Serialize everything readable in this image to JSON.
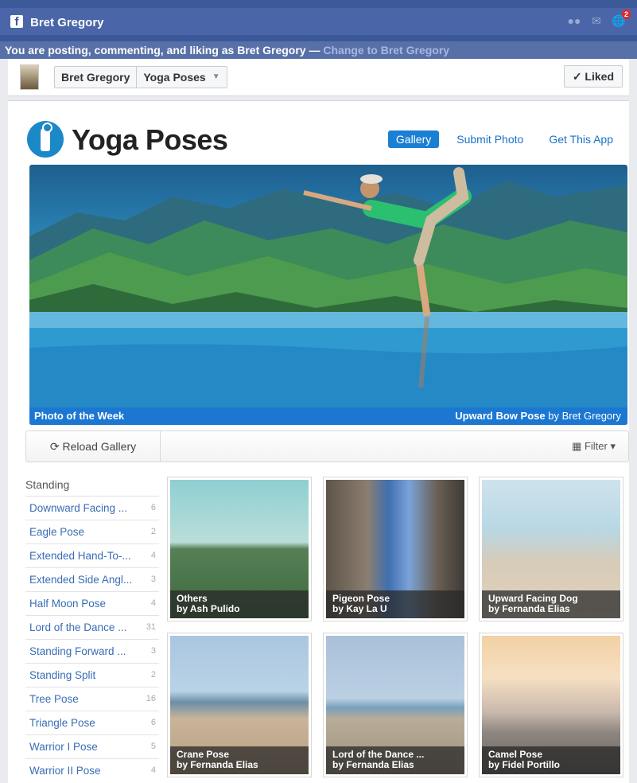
{
  "fb": {
    "user_name": "Bret Gregory",
    "notification_count": "2"
  },
  "posting_bar": {
    "message": "You are posting, commenting, and liking as Bret Gregory — ",
    "change_link": "Change to Bret Gregory"
  },
  "page_bar": {
    "profile": "Bret Gregory",
    "page": "Yoga Poses",
    "liked_label": "✓ Liked"
  },
  "app": {
    "title": "Yoga Poses",
    "nav": [
      {
        "label": "Gallery",
        "active": true
      },
      {
        "label": "Submit Photo",
        "active": false
      },
      {
        "label": "Get This App",
        "active": false
      }
    ]
  },
  "hero": {
    "caption_left": "Photo of the Week",
    "pose": "Upward Bow Pose",
    "by_word": " by ",
    "author": "Bret Gregory"
  },
  "toolbar": {
    "reload_label": "Reload Gallery",
    "filter_label": "Filter"
  },
  "sidebar": {
    "heading": "Standing",
    "items": [
      {
        "label": "Downward Facing ...",
        "count": "6"
      },
      {
        "label": "Eagle Pose",
        "count": "2"
      },
      {
        "label": "Extended Hand-To-...",
        "count": "4"
      },
      {
        "label": "Extended Side Angl...",
        "count": "3"
      },
      {
        "label": "Half Moon Pose",
        "count": "4"
      },
      {
        "label": "Lord of the Dance ...",
        "count": "31"
      },
      {
        "label": "Standing Forward ...",
        "count": "3"
      },
      {
        "label": "Standing Split",
        "count": "2"
      },
      {
        "label": "Tree Pose",
        "count": "16"
      },
      {
        "label": "Triangle Pose",
        "count": "6"
      },
      {
        "label": "Warrior I Pose",
        "count": "5"
      },
      {
        "label": "Warrior II Pose",
        "count": "4"
      }
    ]
  },
  "gallery": [
    {
      "title": "Others",
      "by": "by Ash Pulido"
    },
    {
      "title": "Pigeon Pose",
      "by": "by Kay La U"
    },
    {
      "title": "Upward Facing Dog",
      "by": "by Fernanda Elias"
    },
    {
      "title": "Crane Pose",
      "by": "by Fernanda Elias"
    },
    {
      "title": "Lord of the Dance ...",
      "by": "by Fernanda Elias"
    },
    {
      "title": "Camel Pose",
      "by": "by Fidel Portillo"
    }
  ]
}
